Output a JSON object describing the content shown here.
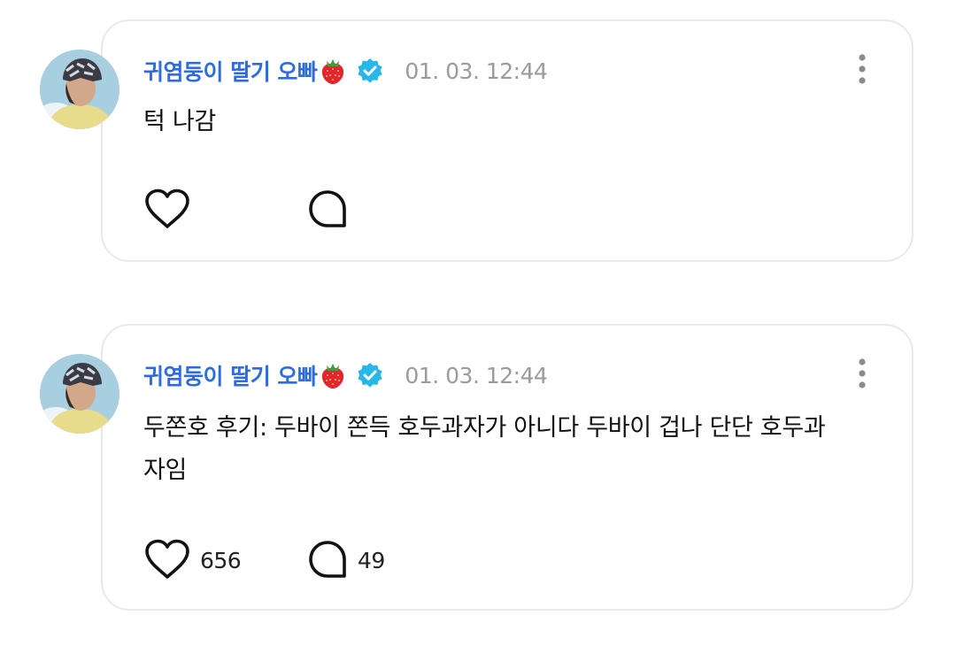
{
  "posts": [
    {
      "username": "귀염둥이 딸기 오빠",
      "username_emoji": "strawberry-icon",
      "verified": true,
      "timestamp": "01. 03. 12:44",
      "content": "턱 나감",
      "likes": "",
      "comments": ""
    },
    {
      "username": "귀염둥이 딸기 오빠",
      "username_emoji": "strawberry-icon",
      "verified": true,
      "timestamp": "01. 03. 12:44",
      "content": "두쫀호 후기: 두바이 쫀득 호두과자가 아니다 두바이 겁나 단단 호두과자임",
      "likes": "656",
      "comments": "49"
    }
  ],
  "colors": {
    "username": "#2d6cdf",
    "verified_badge": "#29b6e8",
    "timestamp": "#9a9a9f",
    "card_border": "#e9e9ec",
    "text": "#111111"
  }
}
